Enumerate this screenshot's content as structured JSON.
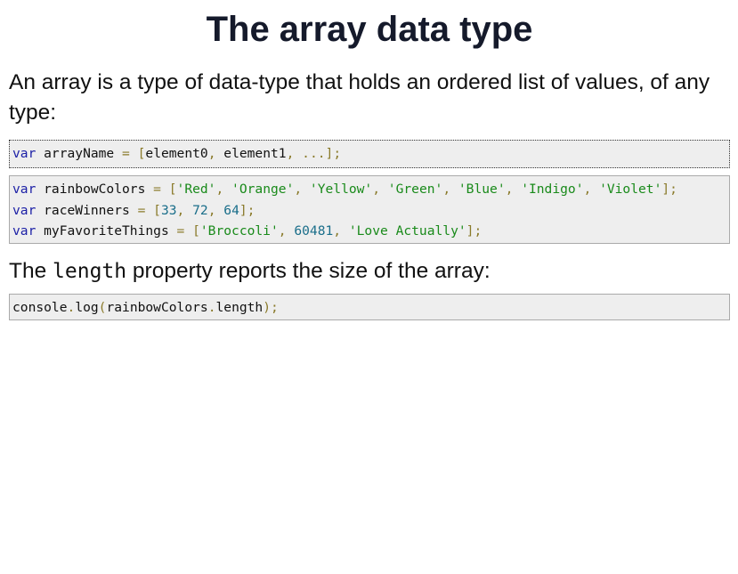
{
  "page": {
    "title": "The array data type",
    "intro": "An array is a type of data-type that holds an ordered list of values, of any type:",
    "length_para": {
      "before": "The ",
      "code": "length",
      "after": " property reports the size of the array:"
    }
  },
  "code": {
    "syntax": {
      "kw": "var",
      "name": " arrayName ",
      "eq": "=",
      "sp": " ",
      "open": "[",
      "e0": "element0",
      "c1": ",",
      "e1": " element1",
      "c2": ",",
      "dots": " ...",
      "close": "];"
    },
    "line1": {
      "kw": "var",
      "name": " rainbowColors ",
      "eq": "=",
      "open": " [",
      "s1": "'Red'",
      "c1": ", ",
      "s2": "'Orange'",
      "c2": ", ",
      "s3": "'Yellow'",
      "c3": ", ",
      "s4": "'Green'",
      "c4": ", ",
      "s5": "'Blue'",
      "c5": ", ",
      "s6": "'Indigo'",
      "c6": ", ",
      "s7": "'Violet'",
      "close": "];"
    },
    "line2": {
      "kw": "var",
      "name": " raceWinners ",
      "eq": "=",
      "open": " [",
      "n1": "33",
      "c1": ", ",
      "n2": "72",
      "c2": ", ",
      "n3": "64",
      "close": "];"
    },
    "line3": {
      "kw": "var",
      "name": " myFavoriteThings ",
      "eq": "=",
      "open": " [",
      "s1": "'Broccoli'",
      "c1": ", ",
      "n1": "60481",
      "c2": ", ",
      "s2": "'Love Actually'",
      "close": "];"
    },
    "length": {
      "obj": "console",
      "dot1": ".",
      "fn": "log",
      "open": "(",
      "arg": "rainbowColors",
      "dot2": ".",
      "prop": "length",
      "close": ");"
    }
  },
  "colors": {
    "keyword": "#1b1fa6",
    "string": "#198a1a",
    "number": "#1a6e8a",
    "punctuation": "#8a7a2a",
    "code_background": "#eeeeee"
  }
}
